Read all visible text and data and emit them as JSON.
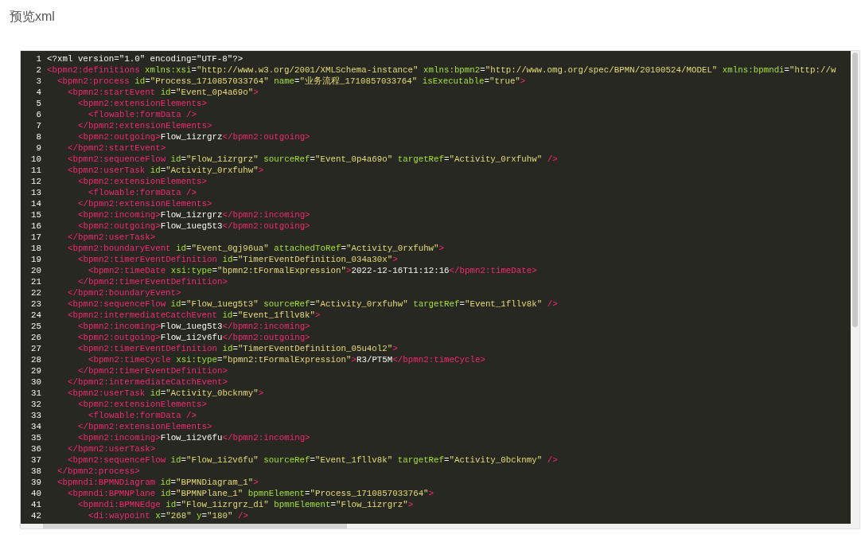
{
  "title": "预览xml",
  "editor": {
    "lines": [
      {
        "number": "1",
        "tokens": [
          {
            "kind": "text",
            "text": "<?xml version=\"1.0\" encoding=\"UTF-8\"?>"
          }
        ]
      },
      {
        "number": "2",
        "tokens": [
          {
            "kind": "tag",
            "text": "<bpmn2:definitions"
          },
          {
            "kind": "attr",
            "text": " xmlns:xsi"
          },
          {
            "kind": "text",
            "text": "="
          },
          {
            "kind": "value",
            "text": "\"http://www.w3.org/2001/XMLSchema-instance\""
          },
          {
            "kind": "attr",
            "text": " xmlns:bpmn2"
          },
          {
            "kind": "text",
            "text": "="
          },
          {
            "kind": "value",
            "text": "\"http://www.omg.org/spec/BPMN/20100524/MODEL\""
          },
          {
            "kind": "attr",
            "text": " xmlns:bpmndi"
          },
          {
            "kind": "text",
            "text": "="
          },
          {
            "kind": "value",
            "text": "\"http://w"
          }
        ],
        "children": [
          {
            "number": "3",
            "tokens": [
              {
                "kind": "tag",
                "text": "<bpmn2:process"
              },
              {
                "kind": "attr",
                "text": " id"
              },
              {
                "kind": "text",
                "text": "="
              },
              {
                "kind": "value",
                "text": "\"Process_1710857033764\""
              },
              {
                "kind": "attr",
                "text": " name"
              },
              {
                "kind": "text",
                "text": "="
              },
              {
                "kind": "value",
                "text": "\"业务流程_1710857033764\""
              },
              {
                "kind": "attr",
                "text": " isExecutable"
              },
              {
                "kind": "text",
                "text": "="
              },
              {
                "kind": "value",
                "text": "\"true\""
              },
              {
                "kind": "tag",
                "text": ">"
              }
            ],
            "children": [
              {
                "number": "4",
                "tokens": [
                  {
                    "kind": "tag",
                    "text": "<bpmn2:startEvent"
                  },
                  {
                    "kind": "attr",
                    "text": " id"
                  },
                  {
                    "kind": "text",
                    "text": "="
                  },
                  {
                    "kind": "value",
                    "text": "\"Event_0p4a69o\""
                  },
                  {
                    "kind": "tag",
                    "text": ">"
                  }
                ],
                "children": [
                  {
                    "number": "5",
                    "tokens": [
                      {
                        "kind": "tag",
                        "text": "<bpmn2:extensionElements>"
                      }
                    ],
                    "children": [
                      {
                        "number": "6",
                        "tokens": [
                          {
                            "kind": "tag",
                            "text": "<flowable:formData />"
                          }
                        ]
                      }
                    ]
                  },
                  {
                    "number": "7",
                    "tokens": [
                      {
                        "kind": "tag",
                        "text": "</bpmn2:extensionElements>"
                      }
                    ]
                  },
                  {
                    "number": "8",
                    "tokens": [
                      {
                        "kind": "tag",
                        "text": "<bpmn2:outgoing>"
                      },
                      {
                        "kind": "text",
                        "text": "Flow_1izrgrz"
                      },
                      {
                        "kind": "tag",
                        "text": "</bpmn2:outgoing>"
                      }
                    ]
                  }
                ]
              },
              {
                "number": "9",
                "tokens": [
                  {
                    "kind": "tag",
                    "text": "</bpmn2:startEvent>"
                  }
                ]
              },
              {
                "number": "10",
                "tokens": [
                  {
                    "kind": "tag",
                    "text": "<bpmn2:sequenceFlow"
                  },
                  {
                    "kind": "attr",
                    "text": " id"
                  },
                  {
                    "kind": "text",
                    "text": "="
                  },
                  {
                    "kind": "value",
                    "text": "\"Flow_1izrgrz\""
                  },
                  {
                    "kind": "attr",
                    "text": " sourceRef"
                  },
                  {
                    "kind": "text",
                    "text": "="
                  },
                  {
                    "kind": "value",
                    "text": "\"Event_0p4a69o\""
                  },
                  {
                    "kind": "attr",
                    "text": " targetRef"
                  },
                  {
                    "kind": "text",
                    "text": "="
                  },
                  {
                    "kind": "value",
                    "text": "\"Activity_0rxfuhw\""
                  },
                  {
                    "kind": "tag",
                    "text": " />"
                  }
                ]
              },
              {
                "number": "11",
                "tokens": [
                  {
                    "kind": "tag",
                    "text": "<bpmn2:userTask"
                  },
                  {
                    "kind": "attr",
                    "text": " id"
                  },
                  {
                    "kind": "text",
                    "text": "="
                  },
                  {
                    "kind": "value",
                    "text": "\"Activity_0rxfuhw\""
                  },
                  {
                    "kind": "tag",
                    "text": ">"
                  }
                ],
                "children": [
                  {
                    "number": "12",
                    "tokens": [
                      {
                        "kind": "tag",
                        "text": "<bpmn2:extensionElements>"
                      }
                    ],
                    "children": [
                      {
                        "number": "13",
                        "tokens": [
                          {
                            "kind": "tag",
                            "text": "<flowable:formData />"
                          }
                        ]
                      }
                    ]
                  },
                  {
                    "number": "14",
                    "tokens": [
                      {
                        "kind": "tag",
                        "text": "</bpmn2:extensionElements>"
                      }
                    ]
                  },
                  {
                    "number": "15",
                    "tokens": [
                      {
                        "kind": "tag",
                        "text": "<bpmn2:incoming>"
                      },
                      {
                        "kind": "text",
                        "text": "Flow_1izrgrz"
                      },
                      {
                        "kind": "tag",
                        "text": "</bpmn2:incoming>"
                      }
                    ]
                  },
                  {
                    "number": "16",
                    "tokens": [
                      {
                        "kind": "tag",
                        "text": "<bpmn2:outgoing>"
                      },
                      {
                        "kind": "text",
                        "text": "Flow_1ueg5t3"
                      },
                      {
                        "kind": "tag",
                        "text": "</bpmn2:outgoing>"
                      }
                    ]
                  }
                ]
              },
              {
                "number": "17",
                "tokens": [
                  {
                    "kind": "tag",
                    "text": "</bpmn2:userTask>"
                  }
                ]
              },
              {
                "number": "18",
                "tokens": [
                  {
                    "kind": "tag",
                    "text": "<bpmn2:boundaryEvent"
                  },
                  {
                    "kind": "attr",
                    "text": " id"
                  },
                  {
                    "kind": "text",
                    "text": "="
                  },
                  {
                    "kind": "value",
                    "text": "\"Event_0gj96ua\""
                  },
                  {
                    "kind": "attr",
                    "text": " attachedToRef"
                  },
                  {
                    "kind": "text",
                    "text": "="
                  },
                  {
                    "kind": "value",
                    "text": "\"Activity_0rxfuhw\""
                  },
                  {
                    "kind": "tag",
                    "text": ">"
                  }
                ],
                "children": [
                  {
                    "number": "19",
                    "tokens": [
                      {
                        "kind": "tag",
                        "text": "<bpmn2:timerEventDefinition"
                      },
                      {
                        "kind": "attr",
                        "text": " id"
                      },
                      {
                        "kind": "text",
                        "text": "="
                      },
                      {
                        "kind": "value",
                        "text": "\"TimerEventDefinition_034a30x\""
                      },
                      {
                        "kind": "tag",
                        "text": ">"
                      }
                    ],
                    "children": [
                      {
                        "number": "20",
                        "tokens": [
                          {
                            "kind": "tag",
                            "text": "<bpmn2:timeDate"
                          },
                          {
                            "kind": "attr",
                            "text": " xsi:type"
                          },
                          {
                            "kind": "text",
                            "text": "="
                          },
                          {
                            "kind": "value",
                            "text": "\"bpmn2:tFormalExpression\""
                          },
                          {
                            "kind": "tag",
                            "text": ">"
                          },
                          {
                            "kind": "text",
                            "text": "2022-12-16T11:12:16"
                          },
                          {
                            "kind": "tag",
                            "text": "</bpmn2:timeDate>"
                          }
                        ]
                      }
                    ]
                  },
                  {
                    "number": "21",
                    "tokens": [
                      {
                        "kind": "tag",
                        "text": "</bpmn2:timerEventDefinition>"
                      }
                    ]
                  }
                ]
              },
              {
                "number": "22",
                "tokens": [
                  {
                    "kind": "tag",
                    "text": "</bpmn2:boundaryEvent>"
                  }
                ]
              },
              {
                "number": "23",
                "tokens": [
                  {
                    "kind": "tag",
                    "text": "<bpmn2:sequenceFlow"
                  },
                  {
                    "kind": "attr",
                    "text": " id"
                  },
                  {
                    "kind": "text",
                    "text": "="
                  },
                  {
                    "kind": "value",
                    "text": "\"Flow_1ueg5t3\""
                  },
                  {
                    "kind": "attr",
                    "text": " sourceRef"
                  },
                  {
                    "kind": "text",
                    "text": "="
                  },
                  {
                    "kind": "value",
                    "text": "\"Activity_0rxfuhw\""
                  },
                  {
                    "kind": "attr",
                    "text": " targetRef"
                  },
                  {
                    "kind": "text",
                    "text": "="
                  },
                  {
                    "kind": "value",
                    "text": "\"Event_1fllv8k\""
                  },
                  {
                    "kind": "tag",
                    "text": " />"
                  }
                ]
              },
              {
                "number": "24",
                "tokens": [
                  {
                    "kind": "tag",
                    "text": "<bpmn2:intermediateCatchEvent"
                  },
                  {
                    "kind": "attr",
                    "text": " id"
                  },
                  {
                    "kind": "text",
                    "text": "="
                  },
                  {
                    "kind": "value",
                    "text": "\"Event_1fllv8k\""
                  },
                  {
                    "kind": "tag",
                    "text": ">"
                  }
                ],
                "children": [
                  {
                    "number": "25",
                    "tokens": [
                      {
                        "kind": "tag",
                        "text": "<bpmn2:incoming>"
                      },
                      {
                        "kind": "text",
                        "text": "Flow_1ueg5t3"
                      },
                      {
                        "kind": "tag",
                        "text": "</bpmn2:incoming>"
                      }
                    ]
                  },
                  {
                    "number": "26",
                    "tokens": [
                      {
                        "kind": "tag",
                        "text": "<bpmn2:outgoing>"
                      },
                      {
                        "kind": "text",
                        "text": "Flow_1i2v6fu"
                      },
                      {
                        "kind": "tag",
                        "text": "</bpmn2:outgoing>"
                      }
                    ]
                  },
                  {
                    "number": "27",
                    "tokens": [
                      {
                        "kind": "tag",
                        "text": "<bpmn2:timerEventDefinition"
                      },
                      {
                        "kind": "attr",
                        "text": " id"
                      },
                      {
                        "kind": "text",
                        "text": "="
                      },
                      {
                        "kind": "value",
                        "text": "\"TimerEventDefinition_05u4ol2\""
                      },
                      {
                        "kind": "tag",
                        "text": ">"
                      }
                    ],
                    "children": [
                      {
                        "number": "28",
                        "tokens": [
                          {
                            "kind": "tag",
                            "text": "<bpmn2:timeCycle"
                          },
                          {
                            "kind": "attr",
                            "text": " xsi:type"
                          },
                          {
                            "kind": "text",
                            "text": "="
                          },
                          {
                            "kind": "value",
                            "text": "\"bpmn2:tFormalExpression\""
                          },
                          {
                            "kind": "tag",
                            "text": ">"
                          },
                          {
                            "kind": "text",
                            "text": "R3/PT5M"
                          },
                          {
                            "kind": "tag",
                            "text": "</bpmn2:timeCycle>"
                          }
                        ]
                      }
                    ]
                  },
                  {
                    "number": "29",
                    "tokens": [
                      {
                        "kind": "tag",
                        "text": "</bpmn2:timerEventDefinition>"
                      }
                    ]
                  }
                ]
              },
              {
                "number": "30",
                "tokens": [
                  {
                    "kind": "tag",
                    "text": "</bpmn2:intermediateCatchEvent>"
                  }
                ]
              },
              {
                "number": "31",
                "tokens": [
                  {
                    "kind": "tag",
                    "text": "<bpmn2:userTask"
                  },
                  {
                    "kind": "attr",
                    "text": " id"
                  },
                  {
                    "kind": "text",
                    "text": "="
                  },
                  {
                    "kind": "value",
                    "text": "\"Activity_0bcknmy\""
                  },
                  {
                    "kind": "tag",
                    "text": ">"
                  }
                ],
                "children": [
                  {
                    "number": "32",
                    "tokens": [
                      {
                        "kind": "tag",
                        "text": "<bpmn2:extensionElements>"
                      }
                    ],
                    "children": [
                      {
                        "number": "33",
                        "tokens": [
                          {
                            "kind": "tag",
                            "text": "<flowable:formData />"
                          }
                        ]
                      }
                    ]
                  },
                  {
                    "number": "34",
                    "tokens": [
                      {
                        "kind": "tag",
                        "text": "</bpmn2:extensionElements>"
                      }
                    ]
                  },
                  {
                    "number": "35",
                    "tokens": [
                      {
                        "kind": "tag",
                        "text": "<bpmn2:incoming>"
                      },
                      {
                        "kind": "text",
                        "text": "Flow_1i2v6fu"
                      },
                      {
                        "kind": "tag",
                        "text": "</bpmn2:incoming>"
                      }
                    ]
                  }
                ]
              },
              {
                "number": "36",
                "tokens": [
                  {
                    "kind": "tag",
                    "text": "</bpmn2:userTask>"
                  }
                ]
              },
              {
                "number": "37",
                "tokens": [
                  {
                    "kind": "tag",
                    "text": "<bpmn2:sequenceFlow"
                  },
                  {
                    "kind": "attr",
                    "text": " id"
                  },
                  {
                    "kind": "text",
                    "text": "="
                  },
                  {
                    "kind": "value",
                    "text": "\"Flow_1i2v6fu\""
                  },
                  {
                    "kind": "attr",
                    "text": " sourceRef"
                  },
                  {
                    "kind": "text",
                    "text": "="
                  },
                  {
                    "kind": "value",
                    "text": "\"Event_1fllv8k\""
                  },
                  {
                    "kind": "attr",
                    "text": " targetRef"
                  },
                  {
                    "kind": "text",
                    "text": "="
                  },
                  {
                    "kind": "value",
                    "text": "\"Activity_0bcknmy\""
                  },
                  {
                    "kind": "tag",
                    "text": " />"
                  }
                ]
              }
            ]
          },
          {
            "number": "38",
            "tokens": [
              {
                "kind": "tag",
                "text": "</bpmn2:process>"
              }
            ]
          },
          {
            "number": "39",
            "tokens": [
              {
                "kind": "tag",
                "text": "<bpmndi:BPMNDiagram"
              },
              {
                "kind": "attr",
                "text": " id"
              },
              {
                "kind": "text",
                "text": "="
              },
              {
                "kind": "value",
                "text": "\"BPMNDiagram_1\""
              },
              {
                "kind": "tag",
                "text": ">"
              }
            ],
            "children": [
              {
                "number": "40",
                "tokens": [
                  {
                    "kind": "tag",
                    "text": "<bpmndi:BPMNPlane"
                  },
                  {
                    "kind": "attr",
                    "text": " id"
                  },
                  {
                    "kind": "text",
                    "text": "="
                  },
                  {
                    "kind": "value",
                    "text": "\"BPMNPlane_1\""
                  },
                  {
                    "kind": "attr",
                    "text": " bpmnElement"
                  },
                  {
                    "kind": "text",
                    "text": "="
                  },
                  {
                    "kind": "value",
                    "text": "\"Process_1710857033764\""
                  },
                  {
                    "kind": "tag",
                    "text": ">"
                  }
                ],
                "children": [
                  {
                    "number": "41",
                    "tokens": [
                      {
                        "kind": "tag",
                        "text": "<bpmndi:BPMNEdge"
                      },
                      {
                        "kind": "attr",
                        "text": " id"
                      },
                      {
                        "kind": "text",
                        "text": "="
                      },
                      {
                        "kind": "value",
                        "text": "\"Flow_1izrgrz_di\""
                      },
                      {
                        "kind": "attr",
                        "text": " bpmnElement"
                      },
                      {
                        "kind": "text",
                        "text": "="
                      },
                      {
                        "kind": "value",
                        "text": "\"Flow_1izrgrz\""
                      },
                      {
                        "kind": "tag",
                        "text": ">"
                      }
                    ],
                    "children": [
                      {
                        "number": "42",
                        "tokens": [
                          {
                            "kind": "tag",
                            "text": "<di:waypoint"
                          },
                          {
                            "kind": "attr",
                            "text": " x"
                          },
                          {
                            "kind": "text",
                            "text": "="
                          },
                          {
                            "kind": "value",
                            "text": "\"268\""
                          },
                          {
                            "kind": "attr",
                            "text": " y"
                          },
                          {
                            "kind": "text",
                            "text": "="
                          },
                          {
                            "kind": "value",
                            "text": "\"180\""
                          },
                          {
                            "kind": "tag",
                            "text": " />"
                          }
                        ]
                      }
                    ]
                  }
                ]
              }
            ]
          }
        ]
      }
    ]
  }
}
